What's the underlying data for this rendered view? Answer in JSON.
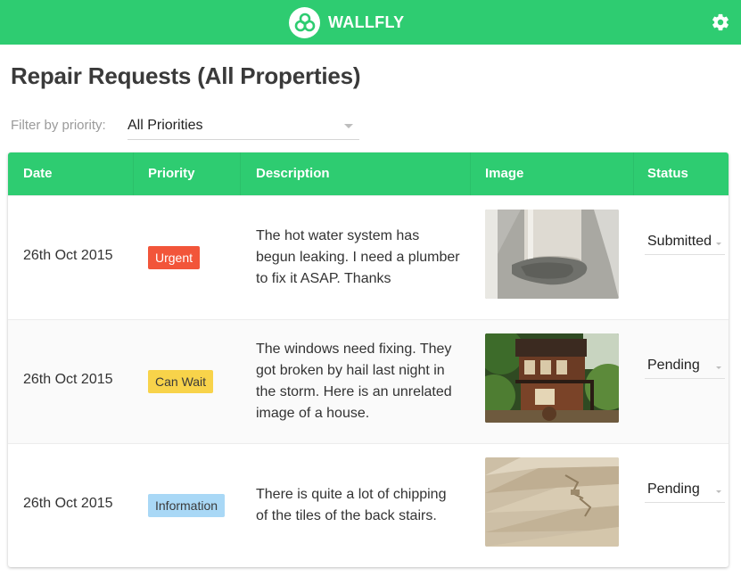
{
  "header": {
    "brand_name": "WALLFLY",
    "logo_icon": "wallfly-logo-icon",
    "settings_icon": "gear-icon",
    "brand_color": "#2ecc71"
  },
  "page": {
    "title": "Repair Requests (All Properties)"
  },
  "filter": {
    "label": "Filter by priority:",
    "value": "All Priorities"
  },
  "table": {
    "columns": [
      "Date",
      "Priority",
      "Description",
      "Image",
      "Status"
    ],
    "rows": [
      {
        "date": "26th Oct 2015",
        "priority": "Urgent",
        "priority_color": "#f2553a",
        "description": "The hot water system has begun leaking. I need a plumber to fix it ASAP. Thanks",
        "image": "hot-water-leak-photo",
        "status": "Submitted"
      },
      {
        "date": "26th Oct 2015",
        "priority": "Can Wait",
        "priority_color": "#f8d34a",
        "description": "The windows need fixing. They got broken by hail last night in the storm. Here is an unrelated image of a house.",
        "image": "house-photo",
        "status": "Pending"
      },
      {
        "date": "26th Oct 2015",
        "priority": "Information",
        "priority_color": "#a9d8f6",
        "description": "There is quite a lot of chipping of the tiles of the back stairs.",
        "image": "chipped-stairs-photo",
        "status": "Pending"
      }
    ]
  }
}
